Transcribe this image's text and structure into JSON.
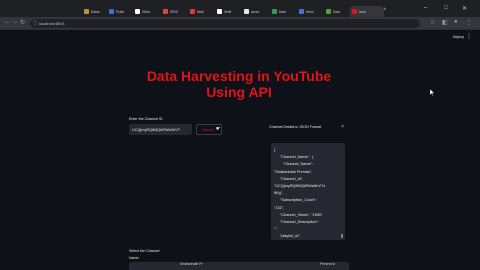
{
  "browser": {
    "tabs": [
      {
        "label": "Datab",
        "color": "#c98a3a"
      },
      {
        "label": "Pytho",
        "color": "#3b6fd6"
      },
      {
        "label": "GitHu",
        "color": "#ffffff"
      },
      {
        "label": "DROI",
        "color": "#d24a3a"
      },
      {
        "label": "Multi",
        "color": "#e53935"
      },
      {
        "label": "Verifi",
        "color": "#ffffff"
      },
      {
        "label": "acces",
        "color": "#e7e7e7"
      },
      {
        "label": "Dash",
        "color": "#3a9a5a"
      },
      {
        "label": "Heroi",
        "color": "#4a6fd6"
      },
      {
        "label": "Dash",
        "color": "#5a9a3a"
      },
      {
        "label": "local",
        "color": "#e2131a"
      }
    ],
    "url": "localhost:8501",
    "window_controls": {
      "minimize": "–",
      "maximize": "□",
      "close": "✕"
    }
  },
  "app": {
    "deploy_label": "Deploy",
    "title_line1": "Data Harvesting in YouTube",
    "title_line2": "Using API",
    "channel_input": {
      "label": "Enter the Channel ID",
      "value": "UCQjmyRQ8MQkRWsNhVT"
    },
    "search_button": "Search",
    "panel": {
      "title": "Channel Details in JSON Format",
      "close": "×",
      "json_lines": [
        "{",
        "\"Channel_Name\" : {",
        "\"Channel_Name\":",
        "\"Shabarinath Premlal\",",
        "\"Channel_Id\":",
        "\"UCQjmyRQ8MQkRWsNhVTz",
        "6Kg\",",
        "\"Subscription_Count\":",
        "\"132\",",
        "\"Channel_Views\": \"1890\",",
        "\"Channel_Description\":",
        "\"\",",
        "\"playlist_id\":"
      ]
    },
    "select_label": "Select the Channel",
    "select_sublabel": "Name",
    "bottom_middle": "Shabarinath Pr",
    "bottom_right": "Present in"
  }
}
